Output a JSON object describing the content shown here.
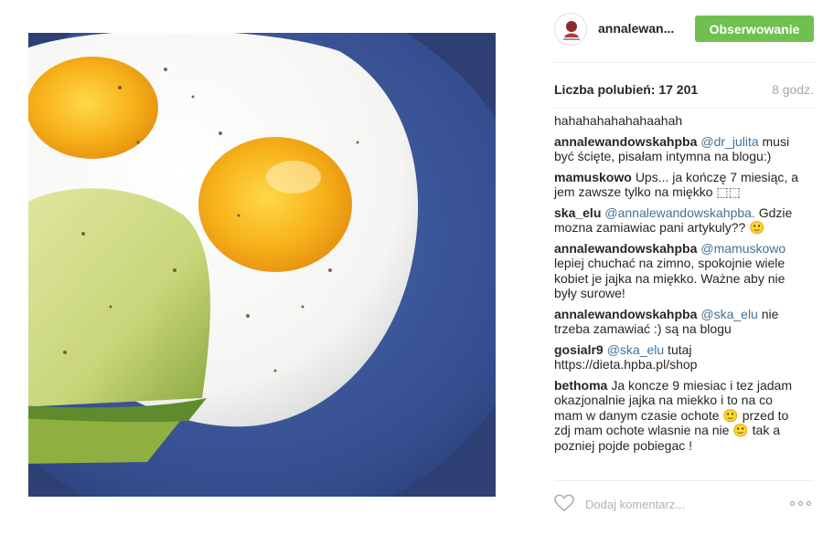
{
  "post": {
    "photo_alt": "eggs-and-avocado-photo"
  },
  "header": {
    "username": "annalewan...",
    "follow_label": "Obserwowanie"
  },
  "stats": {
    "likes": "Liczba polubień: 17 201",
    "time": "8 godz."
  },
  "comments": [
    {
      "author": "",
      "mention": "",
      "text": "hahahahahahahaahah"
    },
    {
      "author": "annalewandowskahpba",
      "mention": "@dr_julita",
      "text": " musi być ścięte, pisałam intymna na blogu:)"
    },
    {
      "author": "mamuskowo",
      "mention": "",
      "text": "Ups... ja kończę 7 miesiąc, a jem zawsze tylko na miękko ⬚⬚"
    },
    {
      "author": "ska_elu",
      "mention": "@annalewandowskahpba.",
      "text": " Gdzie mozna zamiawiac pani artykuly?? 🙂"
    },
    {
      "author": "annalewandowskahpba",
      "mention": "@mamuskowo",
      "text": " lepiej chuchać na zimno, spokojnie wiele kobiet je jajka na miękko. Ważne aby nie były surowe!"
    },
    {
      "author": "annalewandowskahpba",
      "mention": "@ska_elu",
      "text": " nie trzeba zamawiać :) są na blogu"
    },
    {
      "author": "gosialr9",
      "mention": "@ska_elu",
      "text": " tutaj https://dieta.hpba.pl/shop"
    },
    {
      "author": "bethoma",
      "mention": "",
      "text": "Ja koncze 9 miesiac i tez jadam okazjonalnie jajka na miekko i to na co mam w danym czasie ochote 🙂 przed to zdj mam ochote wlasnie na nie 🙂 tak a pozniej pojde pobiegac !"
    }
  ],
  "footer": {
    "add_comment_placeholder": "Dodaj komentarz..."
  },
  "colors": {
    "follow_button": "#70c050",
    "mention": "#3f729b",
    "muted": "#a5a7aa"
  },
  "icons": [
    "avatar",
    "heart-icon",
    "more-options-icon"
  ]
}
